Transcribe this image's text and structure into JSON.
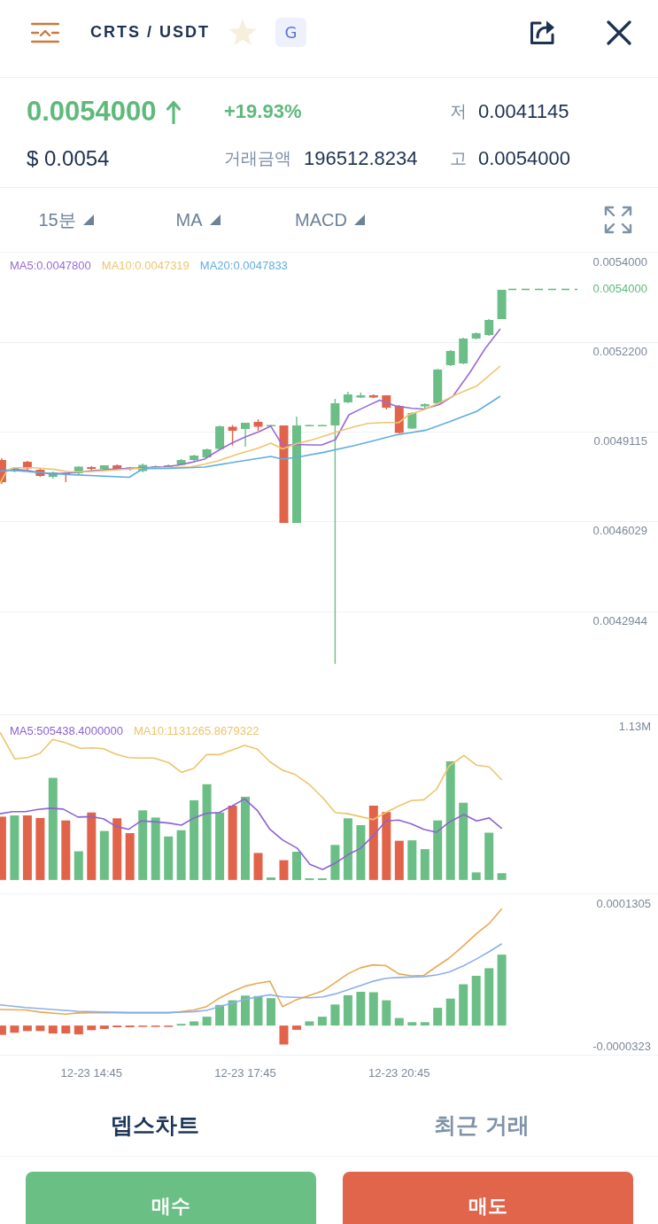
{
  "header": {
    "pair": "CRTS / USDT",
    "favorite": false,
    "badge": "G"
  },
  "ticker": {
    "last_price": "0.0054000",
    "rising": true,
    "change": "+19.93%",
    "low": {
      "label": "저",
      "value": "0.0041145"
    },
    "usd_price": "$ 0.0054",
    "amount": {
      "label": "거래금액",
      "value": "196512.8234"
    },
    "high": {
      "label": "고",
      "value": "0.0054000"
    }
  },
  "toolbar": {
    "dropdowns": [
      "15분",
      "MA",
      "MACD"
    ]
  },
  "price_chart": {
    "legend": [
      {
        "label": "MA5:0.0047800",
        "color": "#9a6bd6"
      },
      {
        "label": "MA10:0.0047319",
        "color": "#edc56f"
      },
      {
        "label": "MA20:0.0047833",
        "color": "#5faee0"
      }
    ],
    "y_labels": [
      "0.0054000",
      "0.0052200",
      "0.0049115",
      "0.0046029",
      "0.0042944"
    ],
    "last_price_label": "0.0054000"
  },
  "volume_chart": {
    "legend": [
      {
        "label": "MA5:505438.4000000",
        "color": "#8e62d3"
      },
      {
        "label": "MA10:1131265.8679322",
        "color": "#ecc46b"
      }
    ],
    "max_label": "1.13M"
  },
  "macd_chart": {
    "max_label": "0.0001305",
    "min_label": "-0.0000323"
  },
  "x_labels": [
    "12-23 14:45",
    "12-23 17:45",
    "12-23 20:45"
  ],
  "tabs": [
    {
      "label": "뎁스차트",
      "selected": true
    },
    {
      "label": "최근 거래",
      "selected": false
    }
  ],
  "actions": [
    {
      "label": "매수",
      "kind": "buy"
    },
    {
      "label": "매도",
      "kind": "sell"
    }
  ]
}
